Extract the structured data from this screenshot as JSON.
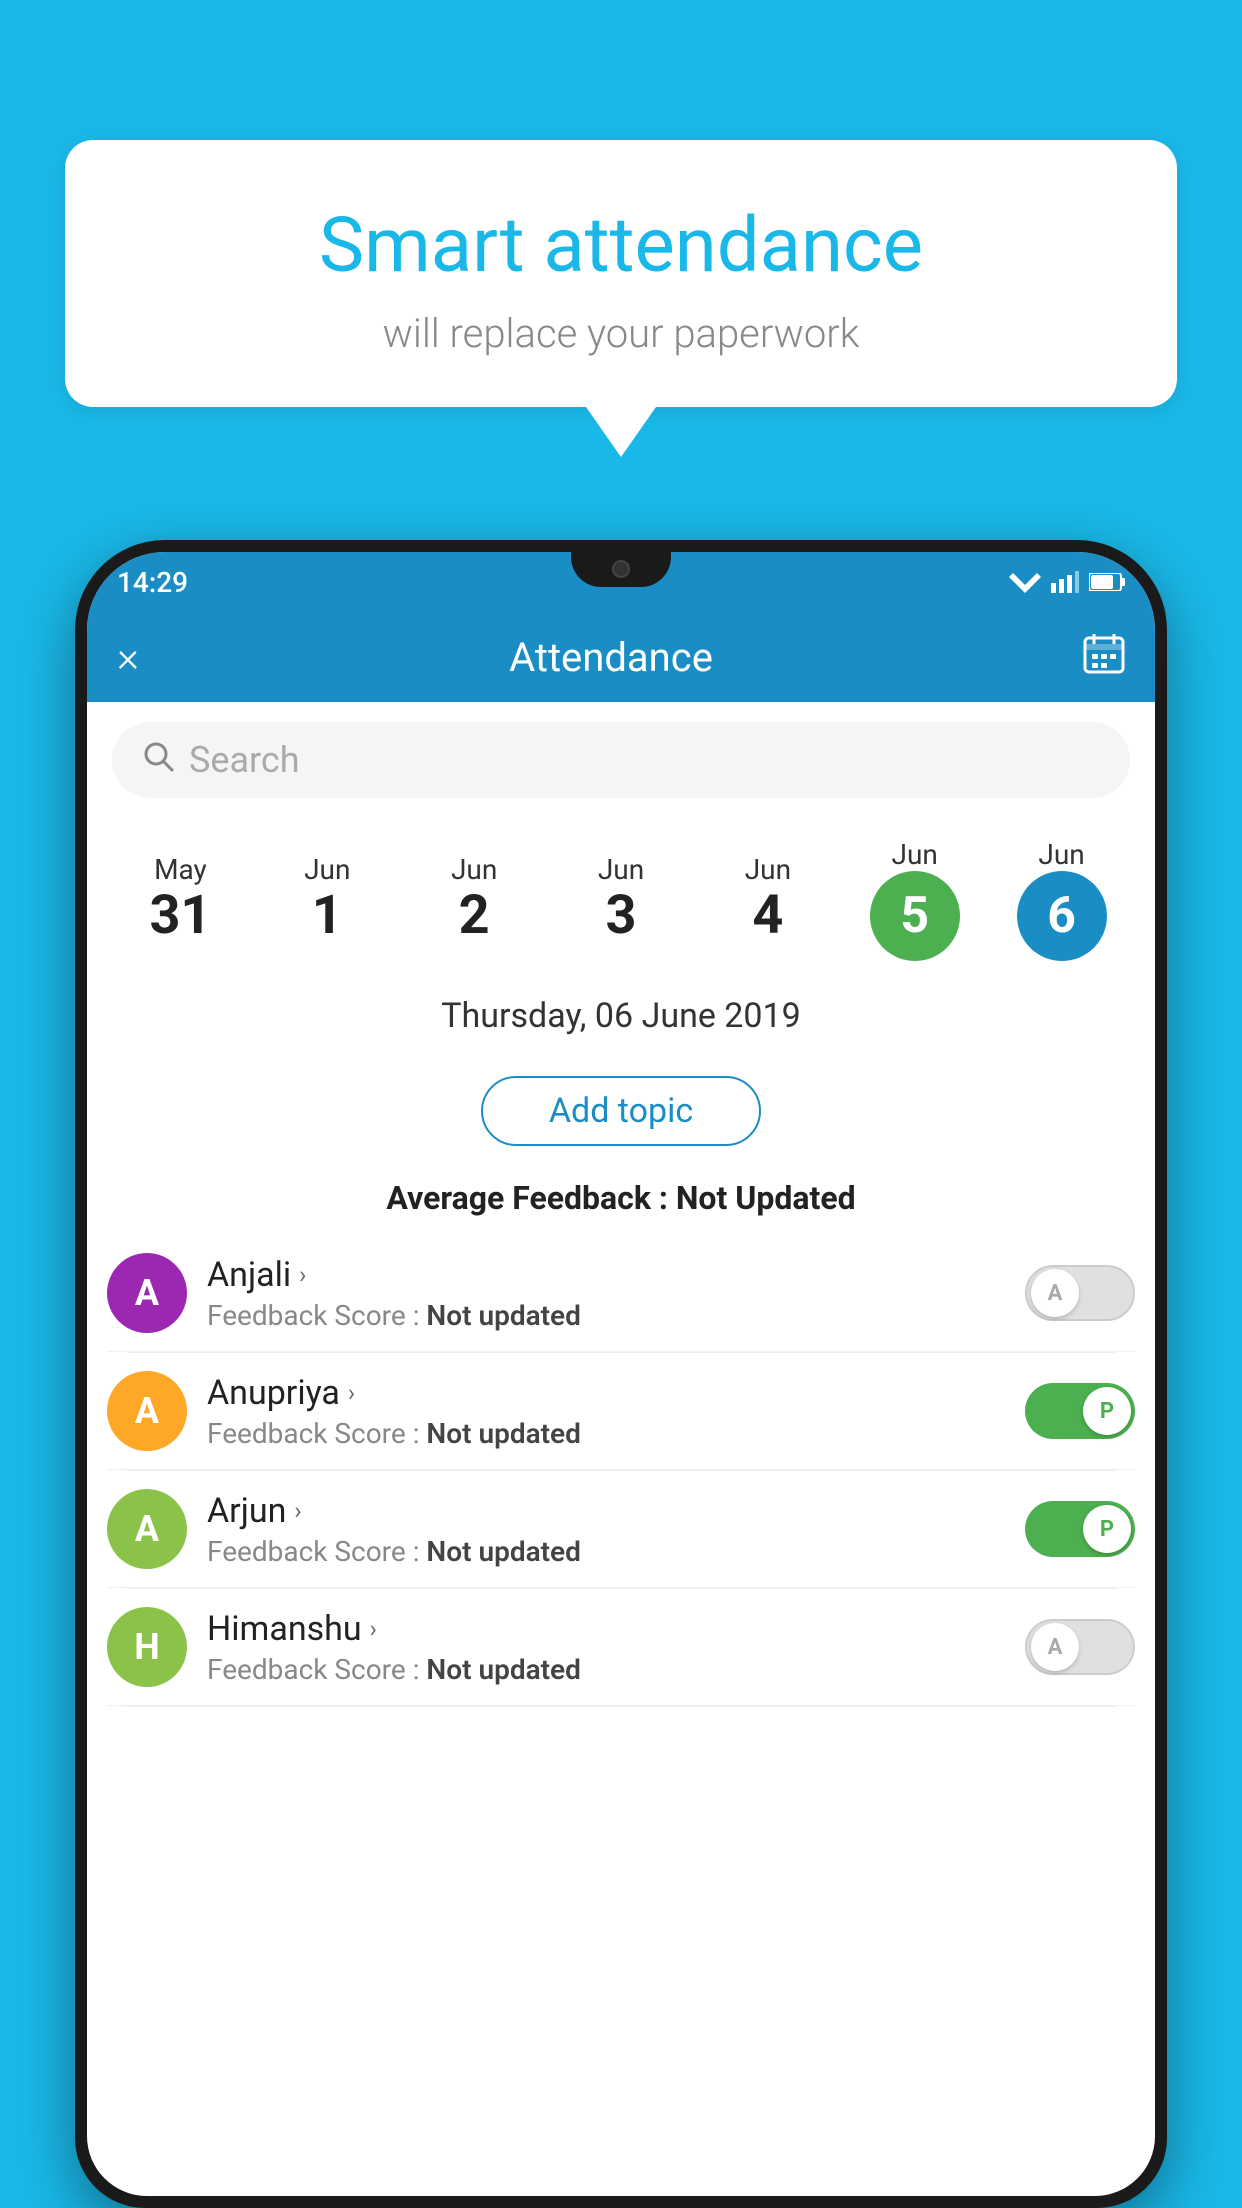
{
  "background_color": "#1ab8e8",
  "speech_bubble": {
    "title": "Smart attendance",
    "subtitle": "will replace your paperwork"
  },
  "status_bar": {
    "time": "14:29"
  },
  "app_header": {
    "title": "Attendance",
    "close_label": "×",
    "calendar_label": "📅"
  },
  "search": {
    "placeholder": "Search"
  },
  "dates": [
    {
      "month": "May",
      "day": "31",
      "selected": false
    },
    {
      "month": "Jun",
      "day": "1",
      "selected": false
    },
    {
      "month": "Jun",
      "day": "2",
      "selected": false
    },
    {
      "month": "Jun",
      "day": "3",
      "selected": false
    },
    {
      "month": "Jun",
      "day": "4",
      "selected": false
    },
    {
      "month": "Jun",
      "day": "5",
      "selected": "green"
    },
    {
      "month": "Jun",
      "day": "6",
      "selected": "blue"
    }
  ],
  "date_label": "Thursday, 06 June 2019",
  "add_topic_label": "Add topic",
  "avg_feedback_label": "Average Feedback :",
  "avg_feedback_value": "Not Updated",
  "students": [
    {
      "name": "Anjali",
      "avatar_letter": "A",
      "avatar_color": "#9c27b0",
      "feedback_label": "Feedback Score :",
      "feedback_value": "Not updated",
      "toggle": "off",
      "toggle_letter": "A"
    },
    {
      "name": "Anupriya",
      "avatar_letter": "A",
      "avatar_color": "#ffa726",
      "feedback_label": "Feedback Score :",
      "feedback_value": "Not updated",
      "toggle": "on",
      "toggle_letter": "P"
    },
    {
      "name": "Arjun",
      "avatar_letter": "A",
      "avatar_color": "#8bc34a",
      "feedback_label": "Feedback Score :",
      "feedback_value": "Not updated",
      "toggle": "on",
      "toggle_letter": "P"
    },
    {
      "name": "Himanshu",
      "avatar_letter": "H",
      "avatar_color": "#8bc34a",
      "feedback_label": "Feedback Score :",
      "feedback_value": "Not updated",
      "toggle": "off",
      "toggle_letter": "A"
    }
  ]
}
